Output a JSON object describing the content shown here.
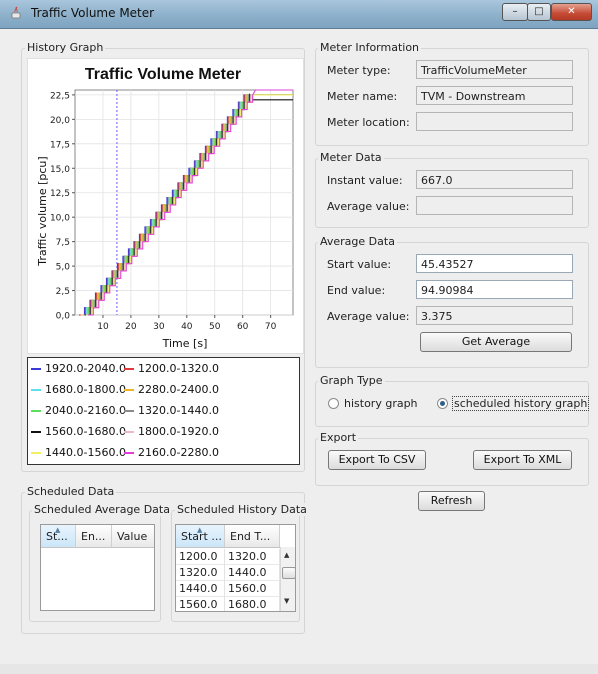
{
  "window": {
    "title": "Traffic Volume Meter",
    "minimize": "–",
    "maximize": "□",
    "close": "✕"
  },
  "history_graph": {
    "legend_title": "History Graph",
    "legend_items": [
      {
        "label": "1920.0-2040.0",
        "color": "#3a3ad8"
      },
      {
        "label": "1200.0-1320.0",
        "color": "#e03a3a"
      },
      {
        "label": "1680.0-1800.0",
        "color": "#5fe0e8"
      },
      {
        "label": "2280.0-2400.0",
        "color": "#f0b429"
      },
      {
        "label": "2040.0-2160.0",
        "color": "#5ce05c"
      },
      {
        "label": "1320.0-1440.0",
        "color": "#8a8a8a"
      },
      {
        "label": "1560.0-1680.0",
        "color": "#111111"
      },
      {
        "label": "1800.0-1920.0",
        "color": "#e8b8c8"
      },
      {
        "label": "1440.0-1560.0",
        "color": "#f0f060"
      },
      {
        "label": "2160.0-2280.0",
        "color": "#e040d8"
      }
    ]
  },
  "chart_data": {
    "type": "line",
    "title": "Traffic Volume Meter",
    "xlabel": "Time [s]",
    "ylabel": "Traffic volume [pcu]",
    "xlim": [
      0,
      78
    ],
    "ylim": [
      0,
      23
    ],
    "x_ticks": [
      "10",
      "20",
      "30",
      "40",
      "50",
      "60",
      "70"
    ],
    "y_ticks": [
      "0,0",
      "2,5",
      "5,0",
      "7,5",
      "10,0",
      "12,5",
      "15,0",
      "17,5",
      "20,0",
      "22,5"
    ],
    "marker_x": 15,
    "series_x": [
      3,
      62
    ],
    "series_y": [
      0,
      22.5
    ],
    "final_levels": [
      22,
      23
    ],
    "grid": true
  },
  "meter_info": {
    "legend": "Meter Information",
    "type_label": "Meter type:",
    "type_value": "TrafficVolumeMeter",
    "name_label": "Meter name:",
    "name_value": "TVM - Downstream",
    "location_label": "Meter location:",
    "location_value": ""
  },
  "meter_data": {
    "legend": "Meter Data",
    "instant_label": "Instant value:",
    "instant_value": "667.0",
    "average_label": "Average value:",
    "average_value": ""
  },
  "average_data": {
    "legend": "Average Data",
    "start_label": "Start value:",
    "start_value": "45.43527",
    "end_label": "End value:",
    "end_value": "94.90984",
    "average_label": "Average value:",
    "average_value": "3.375",
    "button": "Get Average"
  },
  "graph_type": {
    "legend": "Graph Type",
    "option_history": "history graph",
    "option_scheduled": "scheduled history graph",
    "selected": "scheduled history graph"
  },
  "export": {
    "legend": "Export",
    "csv_button": "Export To CSV",
    "xml_button": "Export To XML"
  },
  "refresh_button": "Refresh",
  "scheduled_data": {
    "legend": "Scheduled Data",
    "average": {
      "legend": "Scheduled Average Data",
      "columns": [
        "St...",
        "En...",
        "Value"
      ]
    },
    "history": {
      "legend": "Scheduled History Data",
      "columns": [
        "Start ...",
        "End T..."
      ],
      "rows": [
        [
          "1200.0",
          "1320.0"
        ],
        [
          "1320.0",
          "1440.0"
        ],
        [
          "1440.0",
          "1560.0"
        ],
        [
          "1560.0",
          "1680.0"
        ]
      ]
    }
  }
}
